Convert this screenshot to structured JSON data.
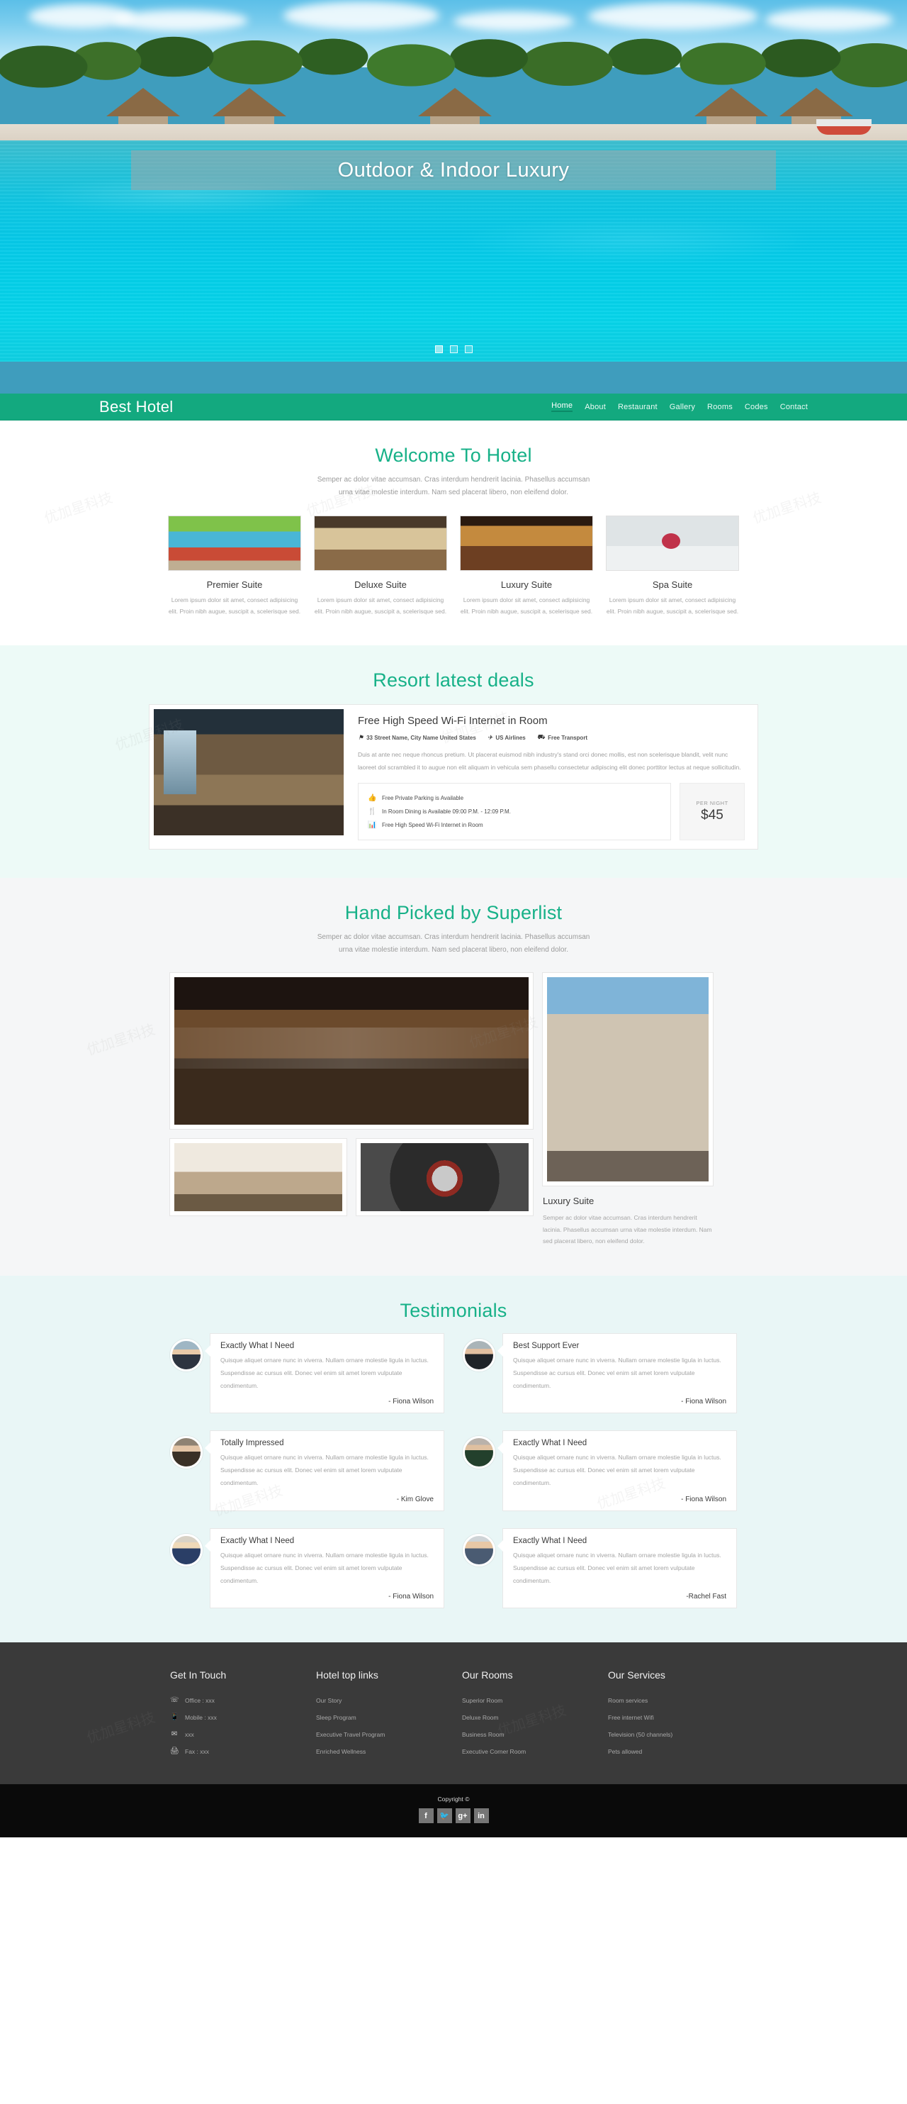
{
  "hero": {
    "title": "Outdoor & Indoor Luxury",
    "dots": [
      "slide-1",
      "slide-2",
      "slide-3"
    ],
    "active_dot": 0
  },
  "nav": {
    "brand": "Best Hotel",
    "links": [
      {
        "label": "Home",
        "active": true
      },
      {
        "label": "About",
        "active": false
      },
      {
        "label": "Restaurant",
        "active": false
      },
      {
        "label": "Gallery",
        "active": false
      },
      {
        "label": "Rooms",
        "active": false
      },
      {
        "label": "Codes",
        "active": false
      },
      {
        "label": "Contact",
        "active": false
      }
    ]
  },
  "welcome": {
    "title": "Welcome To Hotel",
    "subtitle": "Semper ac dolor vitae accumsan. Cras interdum hendrerit lacinia. Phasellus accumsan urna vitae molestie interdum. Nam sed placerat libero, non eleifend dolor.",
    "rooms": [
      {
        "name": "Premier Suite",
        "desc": "Lorem ipsum dolor sit amet, consect adipisicing elit. Proin nibh augue, suscipit a, scelerisque sed."
      },
      {
        "name": "Deluxe Suite",
        "desc": "Lorem ipsum dolor sit amet, consect adipisicing elit. Proin nibh augue, suscipit a, scelerisque sed."
      },
      {
        "name": "Luxury Suite",
        "desc": "Lorem ipsum dolor sit amet, consect adipisicing elit. Proin nibh augue, suscipit a, scelerisque sed."
      },
      {
        "name": "Spa Suite",
        "desc": "Lorem ipsum dolor sit amet, consect adipisicing elit. Proin nibh augue, suscipit a, scelerisque sed."
      }
    ]
  },
  "deals": {
    "title": "Resort latest deals",
    "card": {
      "title": "Free High Speed Wi-Fi Internet in Room",
      "meta": [
        {
          "icon": "location-pin-icon",
          "glyph": "⚑",
          "label": "33 Street Name, City Name United States"
        },
        {
          "icon": "airplane-icon",
          "glyph": "✈",
          "label": "US Airlines"
        },
        {
          "icon": "transport-icon",
          "glyph": "⛟",
          "label": "Free Transport"
        }
      ],
      "text": "Duis at ante nec neque rhoncus pretium. Ut placerat euismod nibh industry's stand orci donec mollis, est non scelerisque blandit, velit nunc laoreet dol scrambled it to augue non elit aliquam in vehicula sem phasellu consectetur adipiscing elit donec porttitor lectus at neque sollicitudin.",
      "features": [
        {
          "icon": "thumbs-up-icon",
          "glyph": "☝",
          "label": "Free Private Parking is Available"
        },
        {
          "icon": "cutlery-icon",
          "glyph": "ἷD",
          "label": "In Room Dining is Available 09:00 P.M. - 12:09 P.M."
        },
        {
          "icon": "signal-bars-icon",
          "glyph": "█",
          "label": "Free High Speed Wi-Fi Internet in Room"
        }
      ],
      "price_label": "PER NIGHT",
      "price_value": "$45"
    }
  },
  "gallery": {
    "title": "Hand Picked by Superlist",
    "subtitle": "Semper ac dolor vitae accumsan. Cras interdum hendrerit lacinia. Phasellus accumsan urna vitae molestie interdum. Nam sed placerat libero, non eleifend dolor.",
    "caption_title": "Luxury Suite",
    "caption_text": "Semper ac dolor vitae accumsan. Cras interdum hendrerit lacinia. Phasellus accumsan urna vitae molestie interdum. Nam sed placerat libero, non eleifend dolor."
  },
  "testimonials": {
    "title": "Testimonials",
    "body": "Quisque aliquet ornare nunc in viverra. Nullam ornare molestie ligula in luctus. Suspendisse ac cursus elit. Donec vel enim sit amet lorem vulputate condimentum.",
    "items": [
      {
        "title": "Exactly What I Need",
        "author": "- Fiona Wilson"
      },
      {
        "title": "Best Support Ever",
        "author": "- Fiona Wilson"
      },
      {
        "title": "Totally Impressed",
        "author": "- Kim Glove"
      },
      {
        "title": "Exactly What I Need",
        "author": "- Fiona Wilson"
      },
      {
        "title": "Exactly What I Need",
        "author": "- Fiona Wilson"
      },
      {
        "title": "Exactly What I Need",
        "author": "-Rachel Fast"
      }
    ]
  },
  "footer": {
    "columns": [
      {
        "title": "Get In Touch",
        "items": [
          {
            "icon": "phone-icon",
            "glyph": "☎",
            "label": "Office : xxx"
          },
          {
            "icon": "mobile-icon",
            "glyph": "☰",
            "label": "Mobile : xxx"
          },
          {
            "icon": "envelope-icon",
            "glyph": "✉",
            "label": "xxx"
          },
          {
            "icon": "fax-icon",
            "glyph": "⎙",
            "label": "Fax : xxx"
          }
        ]
      },
      {
        "title": "Hotel top links",
        "items": [
          {
            "label": "Our Story"
          },
          {
            "label": "Sleep Program"
          },
          {
            "label": "Executive Travel Program"
          },
          {
            "label": "Enriched Wellness"
          }
        ]
      },
      {
        "title": "Our Rooms",
        "items": [
          {
            "label": "Superior Room"
          },
          {
            "label": "Deluxe Room"
          },
          {
            "label": "Business Room"
          },
          {
            "label": "Executive Corner Room"
          }
        ]
      },
      {
        "title": "Our Services",
        "items": [
          {
            "label": "Room services"
          },
          {
            "label": "Free internet Wifi"
          },
          {
            "label": "Television (50 channels)"
          },
          {
            "label": "Pets allowed"
          }
        ]
      }
    ],
    "copyright": "Copyright ©",
    "socials": [
      {
        "icon": "facebook-icon",
        "glyph": "f"
      },
      {
        "icon": "twitter-icon",
        "glyph": "ᴠ"
      },
      {
        "icon": "google-plus-icon",
        "glyph": "g⁺"
      },
      {
        "icon": "linkedin-icon",
        "glyph": "in"
      }
    ]
  },
  "colors": {
    "brand_green": "#13a97f",
    "heading_green": "#17b188",
    "footer_bg": "#3a3a3a",
    "copyright_bg": "#0a0a0a"
  }
}
